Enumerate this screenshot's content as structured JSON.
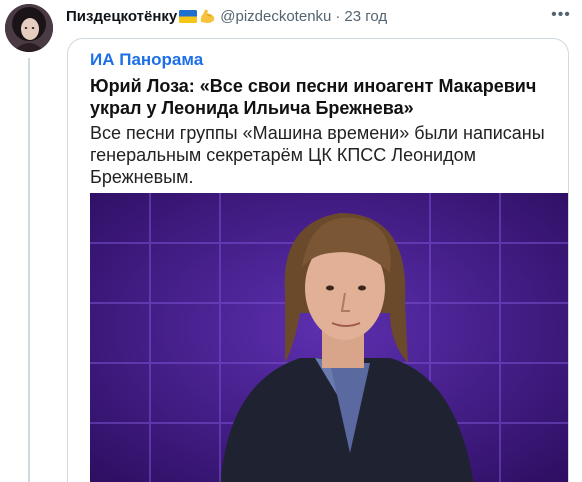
{
  "tweet": {
    "display_name": "Пиздецкотёнку",
    "handle": "@pizdeckotenku",
    "separator": "·",
    "time": "23 год",
    "more_label": "•••",
    "flag_emoji_icon": "ukraine-flag-icon",
    "muscle_emoji_icon": "flexed-biceps-icon"
  },
  "article": {
    "source": "ИА Панорама",
    "headline": "Юрий Лоза: «Все свои песни иноагент Макаревич украл у Леонида Ильича Брежнева»",
    "lede": "Все песни группы «Машина времени» были написаны генеральным секретарём ЦК КПСС Леонидом Брежневым.",
    "photo_icon": "man-portrait-photo",
    "colors": {
      "source": "#1d6fe8",
      "photo_background": "#4b1f8f"
    }
  }
}
